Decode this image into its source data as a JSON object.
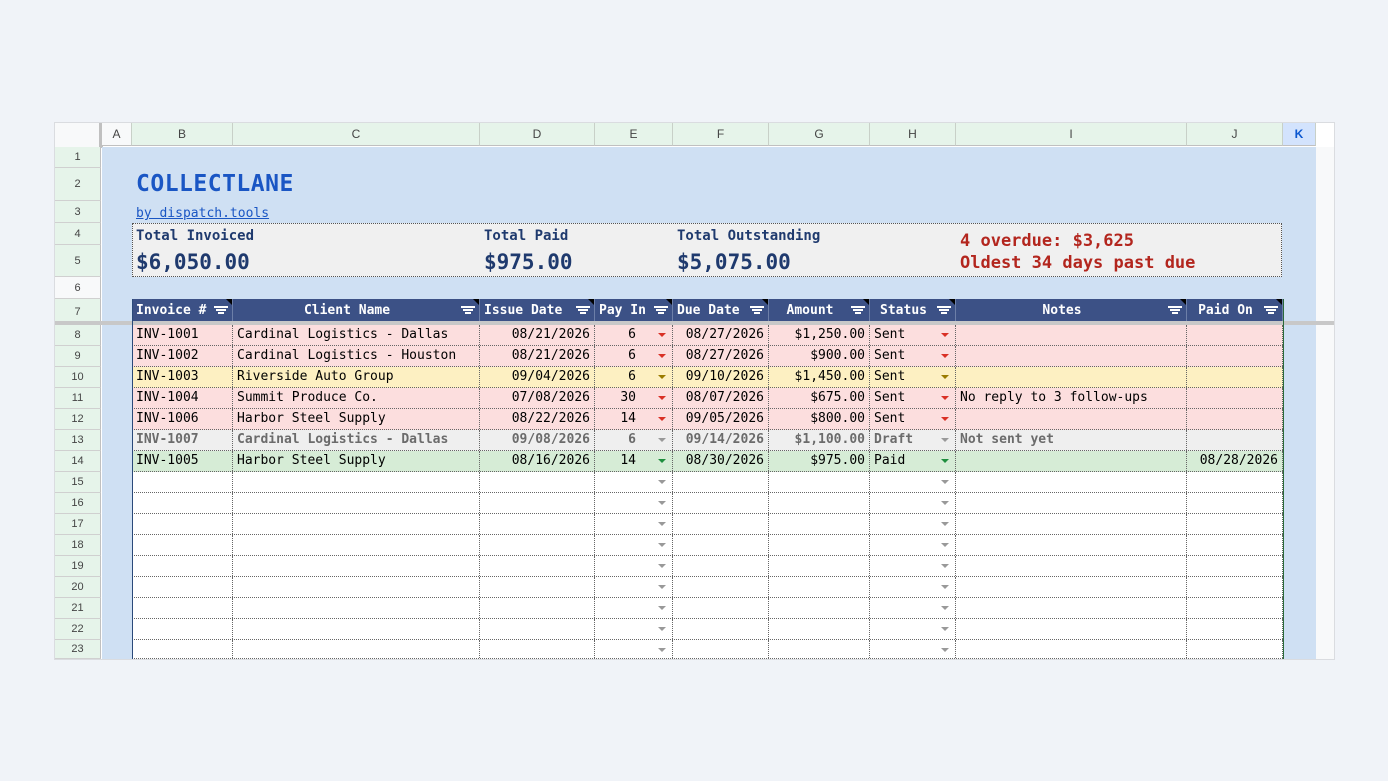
{
  "columns": [
    "A",
    "B",
    "C",
    "D",
    "E",
    "F",
    "G",
    "H",
    "I",
    "J",
    "K"
  ],
  "rows": [
    "1",
    "2",
    "3",
    "4",
    "5",
    "6",
    "7",
    "8",
    "9",
    "10",
    "11",
    "12",
    "13",
    "14",
    "15",
    "16",
    "17",
    "18",
    "19",
    "20",
    "21",
    "22",
    "23"
  ],
  "title": "COLLECTLANE",
  "subtitle_link": "by dispatch.tools",
  "summary": {
    "invoiced_label": "Total Invoiced",
    "invoiced_value": "$6,050.00",
    "paid_label": "Total Paid",
    "paid_value": "$975.00",
    "outstanding_label": "Total Outstanding",
    "outstanding_value": "$5,075.00",
    "alert_line1": "4 overdue: $3,625",
    "alert_line2": "Oldest 34 days past due"
  },
  "headers": [
    "Invoice #",
    "Client Name",
    "Issue Date",
    "Pay In",
    "Due Date",
    "Amount",
    "Status",
    "Notes",
    "Paid On"
  ],
  "invoices": [
    {
      "id": "INV-1001",
      "client": "Cardinal Logistics - Dallas",
      "issue": "08/21/2026",
      "payin": "6",
      "due": "08/27/2026",
      "amount": "$1,250.00",
      "status": "Sent",
      "notes": "",
      "paid_on": "",
      "state": "overdue"
    },
    {
      "id": "INV-1002",
      "client": "Cardinal Logistics - Houston",
      "issue": "08/21/2026",
      "payin": "6",
      "due": "08/27/2026",
      "amount": "$900.00",
      "status": "Sent",
      "notes": "",
      "paid_on": "",
      "state": "overdue"
    },
    {
      "id": "INV-1003",
      "client": "Riverside Auto Group",
      "issue": "09/04/2026",
      "payin": "6",
      "due": "09/10/2026",
      "amount": "$1,450.00",
      "status": "Sent",
      "notes": "",
      "paid_on": "",
      "state": "due"
    },
    {
      "id": "INV-1004",
      "client": "Summit Produce Co.",
      "issue": "07/08/2026",
      "payin": "30",
      "due": "08/07/2026",
      "amount": "$675.00",
      "status": "Sent",
      "notes": "No reply to 3 follow-ups",
      "paid_on": "",
      "state": "overdue"
    },
    {
      "id": "INV-1006",
      "client": "Harbor Steel Supply",
      "issue": "08/22/2026",
      "payin": "14",
      "due": "09/05/2026",
      "amount": "$800.00",
      "status": "Sent",
      "notes": "",
      "paid_on": "",
      "state": "overdue"
    },
    {
      "id": "INV-1007",
      "client": "Cardinal Logistics - Dallas",
      "issue": "09/08/2026",
      "payin": "6",
      "due": "09/14/2026",
      "amount": "$1,100.00",
      "status": "Draft",
      "notes": "Not sent yet",
      "paid_on": "",
      "state": "draft"
    },
    {
      "id": "INV-1005",
      "client": "Harbor Steel Supply",
      "issue": "08/16/2026",
      "payin": "14",
      "due": "08/30/2026",
      "amount": "$975.00",
      "status": "Paid",
      "notes": "",
      "paid_on": "08/28/2026",
      "state": "paid"
    }
  ],
  "colors": {
    "overdue_bg": "#fcdede",
    "due_bg": "#fdf0c2",
    "draft_bg": "#efefef",
    "paid_bg": "#d6ecd6",
    "header_bg": "#3c5186",
    "alert": "#b3261e",
    "brand": "#1a56c4"
  }
}
